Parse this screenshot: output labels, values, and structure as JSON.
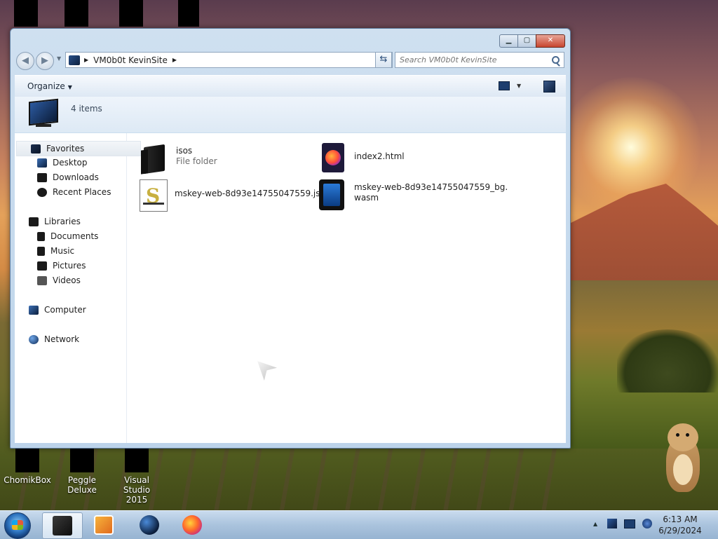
{
  "window": {
    "title": "",
    "buttons": {
      "minimize": "▁",
      "maximize": "▢",
      "close": "✕"
    }
  },
  "navigation": {
    "back": "◀",
    "forward": "▶",
    "breadcrumb": [
      "VM0b0t KevinSite"
    ],
    "search_placeholder": "Search VM0b0t KevinSite"
  },
  "toolbar": {
    "organize": "Organize"
  },
  "info": {
    "count": "4 items"
  },
  "sidebar": {
    "favorites": "Favorites",
    "favorites_items": [
      "Desktop",
      "Downloads",
      "Recent Places"
    ],
    "libraries": "Libraries",
    "libraries_items": [
      "Documents",
      "Music",
      "Pictures",
      "Videos"
    ],
    "computer": "Computer",
    "network": "Network"
  },
  "files": [
    {
      "name": "isos",
      "sub": "File folder",
      "icon": "folder-icon"
    },
    {
      "name": "index2.html",
      "sub": "",
      "icon": "firefox-html-icon"
    },
    {
      "name": "mskey-web-8d93e14755047559.js",
      "sub": "",
      "icon": "script-icon"
    },
    {
      "name": "mskey-web-8d93e14755047559_bg.",
      "name2": "wasm",
      "sub": "",
      "icon": "wasm-icon"
    }
  ],
  "desktop_icons": [
    {
      "label": "ChomikBox"
    },
    {
      "label": "Peggle Deluxe"
    },
    {
      "label": "Visual Studio",
      "label2": "2015"
    }
  ],
  "taskbar": {
    "clock_time": "6:13 AM",
    "clock_date": "6/29/2024"
  }
}
